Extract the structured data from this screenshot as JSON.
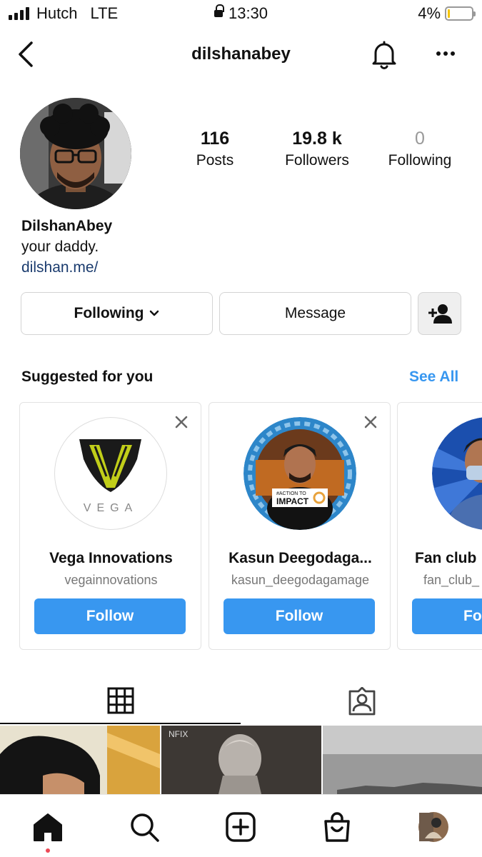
{
  "status_bar": {
    "carrier": "Hutch",
    "network": "LTE",
    "time": "13:30",
    "battery": "4%"
  },
  "header": {
    "username": "dilshanabey"
  },
  "profile": {
    "posts_count": "116",
    "posts_label": "Posts",
    "followers_count": "19.8 k",
    "followers_label": "Followers",
    "following_count": "0",
    "following_label": "Following",
    "full_name": "DilshanAbey",
    "bio": "your daddy.",
    "link": "dilshan.me/"
  },
  "actions": {
    "following_label": "Following",
    "message_label": "Message"
  },
  "suggested": {
    "title": "Suggested for you",
    "see_all": "See All",
    "cards": [
      {
        "name": "Vega Innovations",
        "handle": "vegainnovations",
        "follow_label": "Follow",
        "logo_text": "VEGA"
      },
      {
        "name": "Kasun Deegodaga...",
        "handle": "kasun_deegodagamage",
        "follow_label": "Follow",
        "badge_top": "#ACTION TO",
        "badge_main": "IMPACT"
      },
      {
        "name": "Fan club",
        "handle": "fan_club_",
        "follow_label": "Fo"
      }
    ]
  },
  "grid": {
    "thumb2_text": "NFIX"
  },
  "colors": {
    "accent": "#3897f0",
    "link": "#1a3b6e",
    "notification_dot": "#ed4956"
  }
}
